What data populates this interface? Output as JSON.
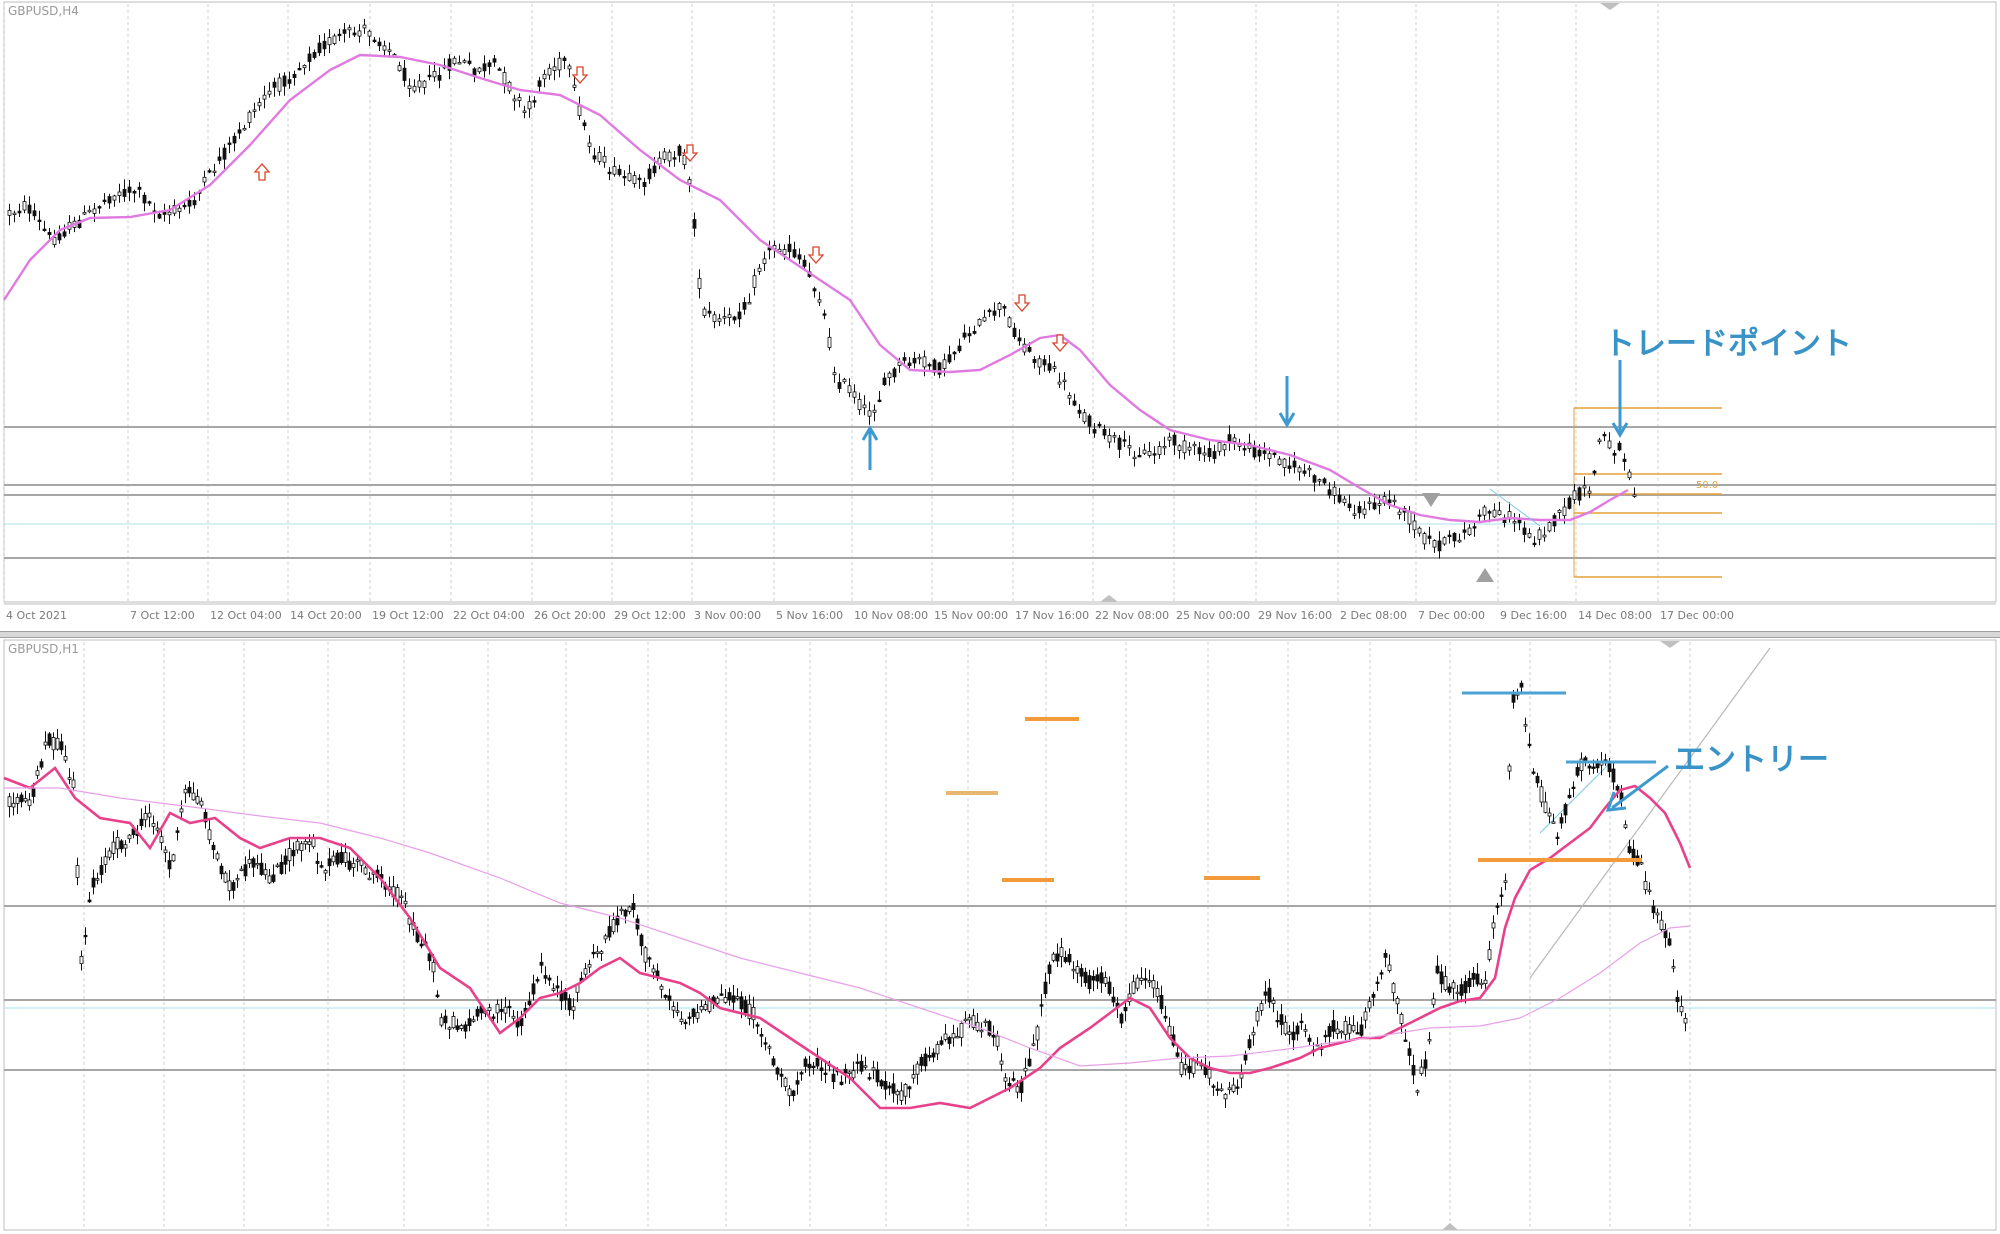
{
  "top": {
    "symbol": "GBPUSD,H4",
    "annotation": "トレードポイント",
    "fib_label": "50.0",
    "x_labels": [
      "4 Oct 2021",
      "7 Oct 12:00",
      "12 Oct 04:00",
      "14 Oct 20:00",
      "19 Oct 12:00",
      "22 Oct 04:00",
      "26 Oct 20:00",
      "29 Oct 12:00",
      "3 Nov 00:00",
      "5 Nov 16:00",
      "10 Nov 08:00",
      "15 Nov 00:00",
      "17 Nov 16:00",
      "22 Nov 08:00",
      "25 Nov 00:00",
      "29 Nov 16:00",
      "2 Dec 08:00",
      "7 Dec 00:00",
      "9 Dec 16:00",
      "14 Dec 08:00",
      "17 Dec 00:00"
    ]
  },
  "bottom": {
    "symbol": "GBPUSD,H1",
    "annotation": "エントリー"
  },
  "colors": {
    "candle": "#111111",
    "ma_top": "#e07ae0",
    "ma_fast": "#e8408a",
    "ma_slow": "#e7a0e7",
    "hline": "#a6a6a6",
    "hline_light": "#a9e1ee",
    "arrow_blue": "#3d9ad0",
    "fib": "#e6a13b",
    "level_orange": "#f39a3a",
    "level_blue": "#4aa3d3",
    "down_arrow": "#d9452b",
    "grid": "#cfcfcf"
  },
  "icons": [
    "down-arrow-icon",
    "up-arrow-icon",
    "triangle-down-icon",
    "triangle-up-icon"
  ]
}
